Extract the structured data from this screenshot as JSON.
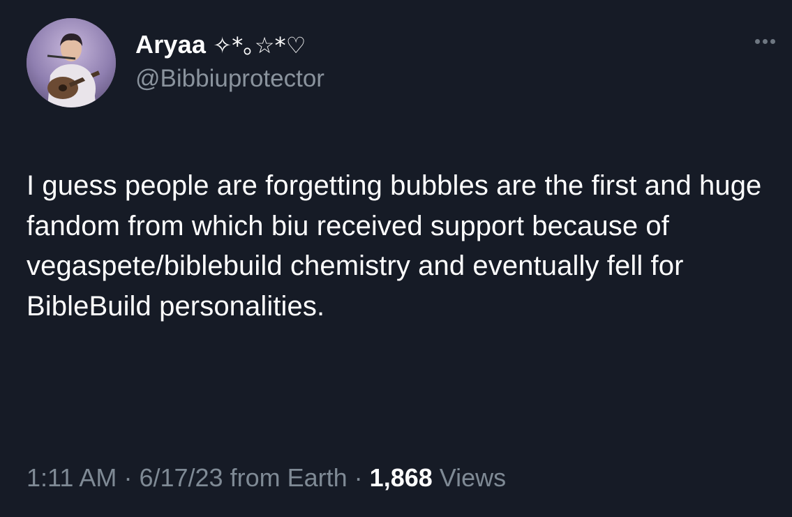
{
  "author": {
    "display_name": "Aryaa",
    "display_name_decoration": "✧*｡☆*♡",
    "handle": "@Bibbiuprotector"
  },
  "tweet": {
    "text": "I guess people are forgetting bubbles are the first and huge fandom from which biu received support because of vegaspete/biblebuild chemistry and eventually fell for BibleBuild personalities."
  },
  "meta": {
    "time": "1:11 AM",
    "date": "6/17/23",
    "source": "from Earth",
    "separator": "·",
    "views_count": "1,868",
    "views_label": "Views"
  },
  "colors": {
    "background": "#161b26",
    "primary_text": "#ffffff",
    "secondary_text": "#8a939d"
  },
  "icons": {
    "more": "more-horizontal-icon"
  }
}
